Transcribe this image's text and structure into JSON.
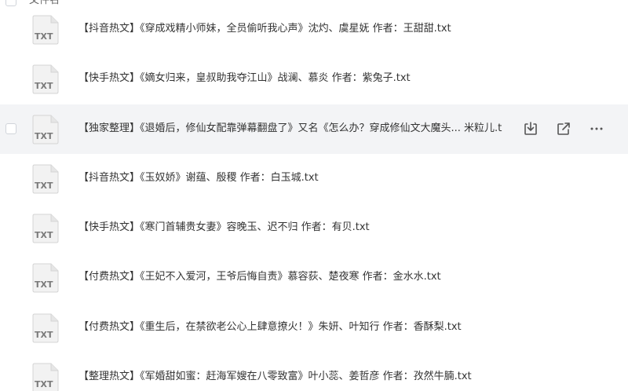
{
  "header": {
    "column_label": "文件名"
  },
  "file_icon_label": "TXT",
  "files": [
    {
      "name": "【抖音热文】《穿成戏精小师妹，全员偷听我心声》沈灼、虞星妩 作者：王甜甜.txt"
    },
    {
      "name": "【快手热文】《嫡女归来，皇叔助我夺江山》战澜、慕炎 作者：紫兔子.txt"
    },
    {
      "name": "【独家整理】《退婚后，修仙女配靠弹幕翻盘了》又名《怎么办？穿成修仙文大魔头... 米粒儿.txt"
    },
    {
      "name": "【抖音热文】《玉奴娇》谢蕴、殷稷 作者：白玉城.txt"
    },
    {
      "name": "【快手热文】《寒门首辅贵女妻》容晚玉、迟不归 作者：有贝.txt"
    },
    {
      "name": "【付费热文】《王妃不入爱河，王爷后悔自责》慕容荻、楚夜寒 作者：金水水.txt"
    },
    {
      "name": "【付费热文】《重生后，在禁欲老公心上肆意撩火！》朱妍、叶知行 作者：香酥梨.txt"
    },
    {
      "name": "【整理热文】《军婚甜如蜜：赶海军嫂在八零致富》叶小蕊、姜哲彦 作者：孜然牛腩.txt"
    }
  ],
  "hovered_row_index": 2,
  "row_actions": {
    "download_icon": "download-icon",
    "share_icon": "share-icon",
    "more_icon": "more-icon",
    "more_glyph": "···"
  },
  "colors": {
    "highlight_row": "#f3f4f6",
    "text": "#333333",
    "icon": "#555555"
  }
}
